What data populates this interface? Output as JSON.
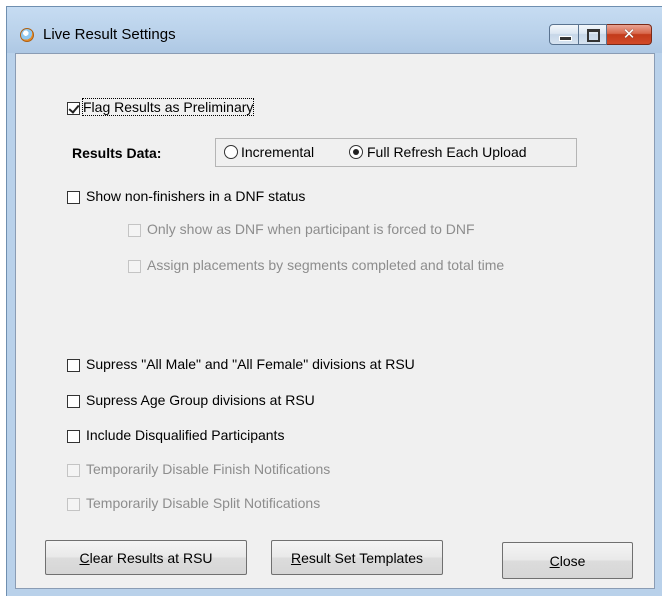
{
  "window": {
    "title": "Live Result Settings",
    "icon": "app-logo-icon",
    "caption_buttons": {
      "minimize": "minimize-icon",
      "maximize": "maximize-icon",
      "close": "✕"
    }
  },
  "options": {
    "flag_preliminary": {
      "label": "Flag Results as Preliminary",
      "checked": true,
      "enabled": true
    },
    "results_data": {
      "label": "Results Data:",
      "choices": [
        {
          "label": "Incremental",
          "selected": false
        },
        {
          "label": "Full Refresh Each Upload",
          "selected": true
        }
      ]
    },
    "show_non_finishers": {
      "label": "Show non-finishers in a DNF status",
      "checked": false,
      "enabled": true
    },
    "only_show_forced_dnf": {
      "label": "Only show as DNF when participant is forced to DNF",
      "checked": false,
      "enabled": false
    },
    "assign_placements": {
      "label": "Assign placements by segments completed and total time",
      "checked": false,
      "enabled": false
    },
    "supress_all_divisions": {
      "label": "Supress \"All Male\" and \"All Female\" divisions at RSU",
      "checked": false,
      "enabled": true
    },
    "supress_age_group": {
      "label": "Supress Age Group divisions at RSU",
      "checked": false,
      "enabled": true
    },
    "include_disqualified": {
      "label": "Include Disqualified Participants",
      "checked": false,
      "enabled": true
    },
    "disable_finish_notifications": {
      "label": "Temporarily Disable Finish Notifications",
      "checked": false,
      "enabled": false
    },
    "disable_split_notifications": {
      "label": "Temporarily Disable Split Notifications",
      "checked": false,
      "enabled": false
    }
  },
  "buttons": {
    "clear_results": {
      "mnemonic": "C",
      "rest": "lear Results at RSU"
    },
    "result_set_templates": {
      "mnemonic": "R",
      "rest": "esult Set Templates"
    },
    "close": {
      "mnemonic": "C",
      "rest": "lose"
    }
  }
}
